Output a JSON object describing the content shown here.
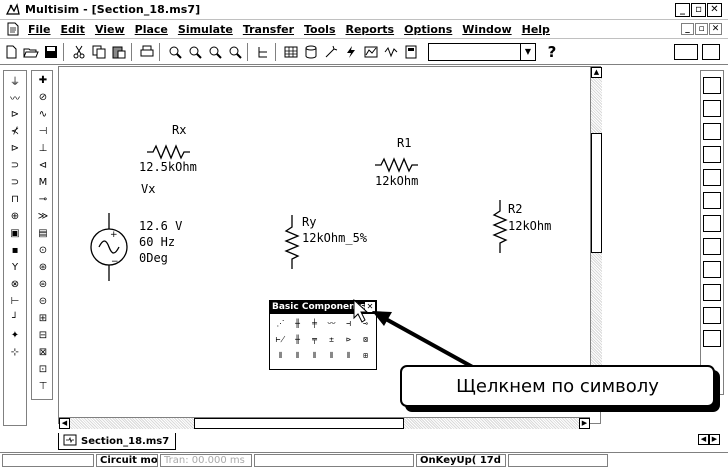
{
  "window": {
    "title": "Multisim - [Section_18.ms7]",
    "buttons": [
      "_",
      "▫",
      "✕"
    ]
  },
  "menubar": {
    "items": [
      "File",
      "Edit",
      "View",
      "Place",
      "Simulate",
      "Transfer",
      "Tools",
      "Reports",
      "Options",
      "Window",
      "Help"
    ],
    "mdi_buttons": [
      "_",
      "▫",
      "✕"
    ]
  },
  "toolbar": {
    "help_label": "?",
    "combo_value": ""
  },
  "schematic": {
    "rx": {
      "name": "Rx",
      "value": "12.5kOhm"
    },
    "r1": {
      "name": "R1",
      "value": "12kOhm"
    },
    "r2": {
      "name": "R2",
      "value": "12kOhm"
    },
    "ry": {
      "name": "Ry",
      "value": "12kOhm_5%"
    },
    "vx": {
      "name": "Vx",
      "voltage": "12.6 V",
      "frequency": "60 Hz",
      "phase": "0Deg"
    }
  },
  "palette": {
    "title": "Basic Components",
    "close": "✕"
  },
  "callout": {
    "text": "Щелкнем по символу"
  },
  "tabs": {
    "document": "Section_18.ms7"
  },
  "status": {
    "cells": [
      "",
      "Circuit modified",
      "Tran: 00.000 ms",
      "",
      "OnKeyUp( 17d )",
      ""
    ]
  }
}
